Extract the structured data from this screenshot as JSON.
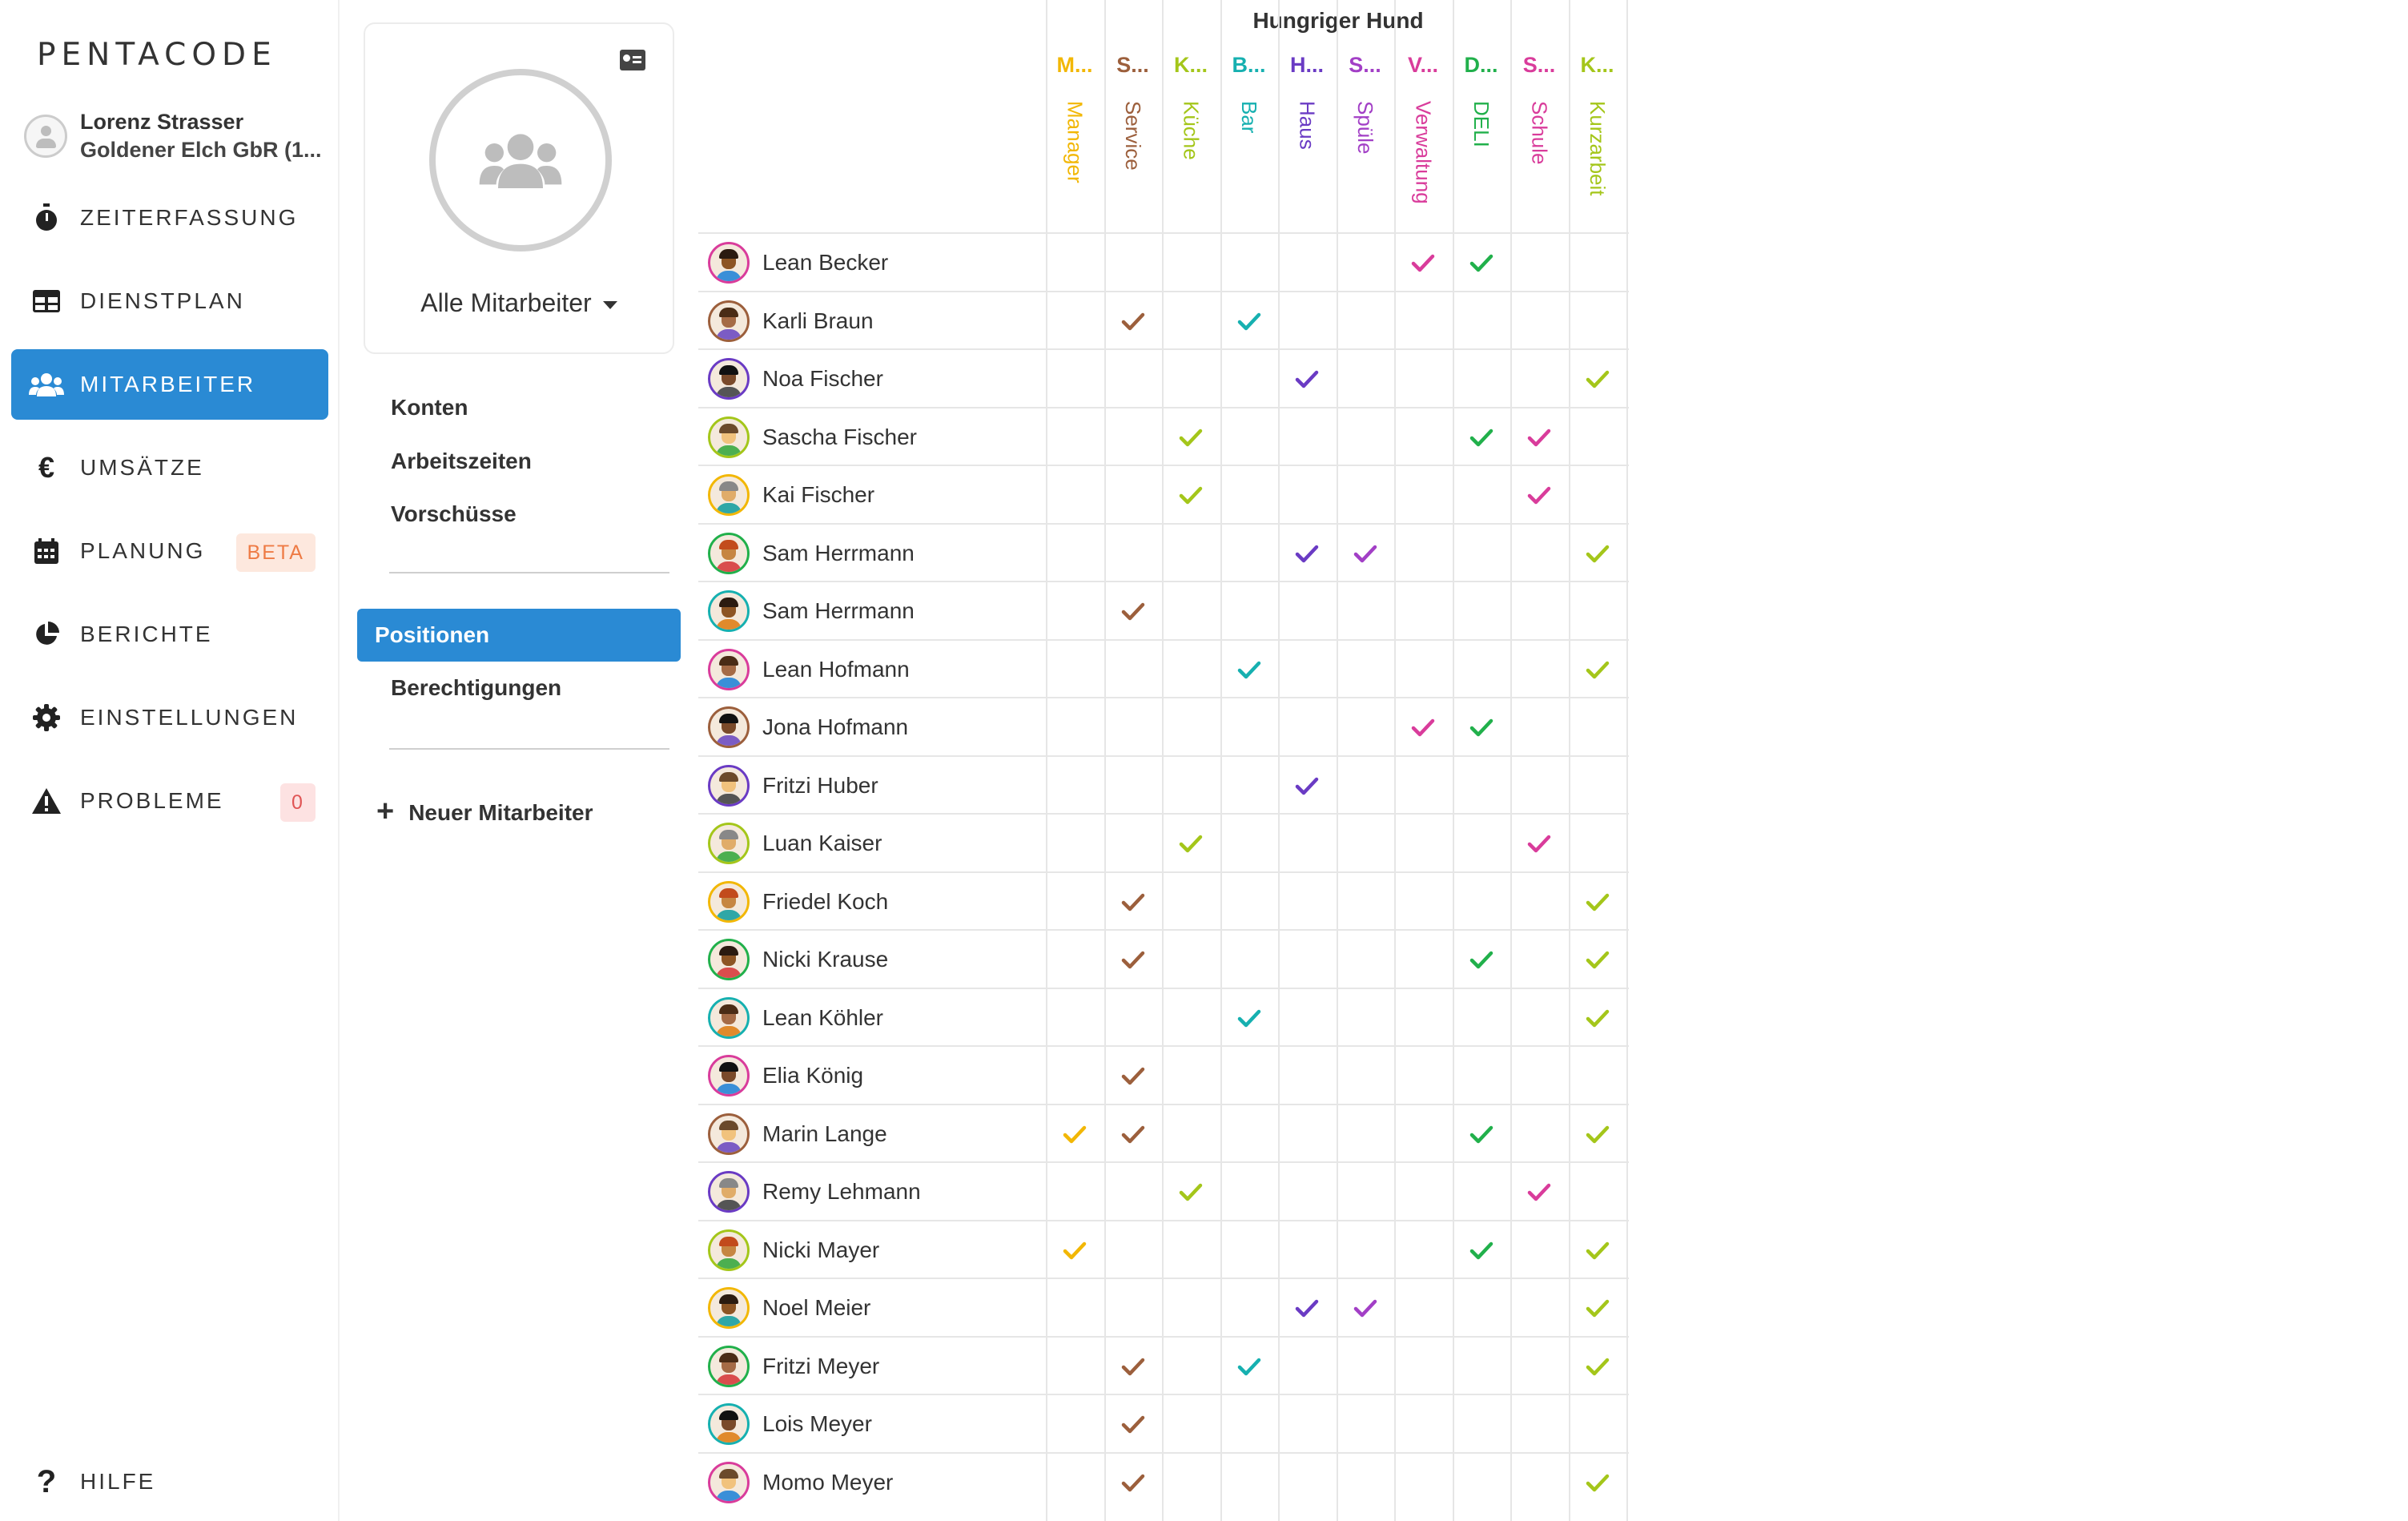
{
  "app": {
    "logo": "PENTACODE",
    "user_name": "Lorenz Strasser",
    "user_company": "Goldener Elch GbR (1..."
  },
  "nav": {
    "items": [
      {
        "label": "ZEITERFASSUNG",
        "icon": "stopwatch-icon"
      },
      {
        "label": "DIENSTPLAN",
        "icon": "table-icon"
      },
      {
        "label": "MITARBEITER",
        "icon": "users-icon",
        "active": true
      },
      {
        "label": "UMSÄTZE",
        "icon": "euro-icon"
      },
      {
        "label": "PLANUNG",
        "icon": "calendar-icon",
        "badge": "BETA"
      },
      {
        "label": "BERICHTE",
        "icon": "pie-chart-icon"
      },
      {
        "label": "EINSTELLUNGEN",
        "icon": "gear-icon"
      },
      {
        "label": "PROBLEME",
        "icon": "warning-icon",
        "badge": "0"
      }
    ],
    "help_label": "HILFE"
  },
  "middle": {
    "group_select_label": "Alle Mitarbeiter",
    "links_top": [
      "Konten",
      "Arbeitszeiten",
      "Vorschüsse"
    ],
    "links_bottom": [
      "Positionen",
      "Berechtigungen"
    ],
    "active_link": "Positionen",
    "new_employee_label": "Neuer Mitarbeiter"
  },
  "matrix": {
    "company": "Hungriger Hund",
    "positions": [
      {
        "abbr": "M...",
        "name": "Manager",
        "color": "#f2b705"
      },
      {
        "abbr": "S...",
        "name": "Service",
        "color": "#9c5f3c"
      },
      {
        "abbr": "K...",
        "name": "Küche",
        "color": "#a4c61a"
      },
      {
        "abbr": "B...",
        "name": "Bar",
        "color": "#16b0b0"
      },
      {
        "abbr": "H...",
        "name": "Haus",
        "color": "#6a3bc4"
      },
      {
        "abbr": "S...",
        "name": "Spüle",
        "color": "#a23fc6"
      },
      {
        "abbr": "V...",
        "name": "Verwaltung",
        "color": "#d93c9b"
      },
      {
        "abbr": "D...",
        "name": "DELI",
        "color": "#21b04b"
      },
      {
        "abbr": "S...",
        "name": "Schule",
        "color": "#d93c9b"
      },
      {
        "abbr": "K...",
        "name": "Kurzarbeit",
        "color": "#a4c61a"
      }
    ],
    "employees": [
      {
        "name": "Lean Becker",
        "positions": [
          6,
          7
        ]
      },
      {
        "name": "Karli Braun",
        "positions": [
          1,
          3
        ]
      },
      {
        "name": "Noa Fischer",
        "positions": [
          4,
          9
        ]
      },
      {
        "name": "Sascha Fischer",
        "positions": [
          2,
          7,
          8
        ]
      },
      {
        "name": "Kai Fischer",
        "positions": [
          2,
          8
        ]
      },
      {
        "name": "Sam Herrmann",
        "positions": [
          4,
          5,
          9
        ]
      },
      {
        "name": "Sam Herrmann",
        "positions": [
          1
        ]
      },
      {
        "name": "Lean Hofmann",
        "positions": [
          3,
          9
        ]
      },
      {
        "name": "Jona Hofmann",
        "positions": [
          6,
          7
        ]
      },
      {
        "name": "Fritzi Huber",
        "positions": [
          4
        ]
      },
      {
        "name": "Luan Kaiser",
        "positions": [
          2,
          8
        ]
      },
      {
        "name": "Friedel Koch",
        "positions": [
          1,
          9
        ]
      },
      {
        "name": "Nicki Krause",
        "positions": [
          1,
          7,
          9
        ]
      },
      {
        "name": "Lean Köhler",
        "positions": [
          3,
          9
        ]
      },
      {
        "name": "Elia König",
        "positions": [
          1
        ]
      },
      {
        "name": "Marin Lange",
        "positions": [
          0,
          1,
          7,
          9
        ]
      },
      {
        "name": "Remy Lehmann",
        "positions": [
          2,
          8
        ]
      },
      {
        "name": "Nicki Mayer",
        "positions": [
          0,
          7,
          9
        ]
      },
      {
        "name": "Noel Meier",
        "positions": [
          4,
          5,
          9
        ]
      },
      {
        "name": "Fritzi Meyer",
        "positions": [
          1,
          3,
          9
        ]
      },
      {
        "name": "Lois Meyer",
        "positions": [
          1
        ]
      },
      {
        "name": "Momo Meyer",
        "positions": [
          1,
          9
        ]
      }
    ]
  }
}
